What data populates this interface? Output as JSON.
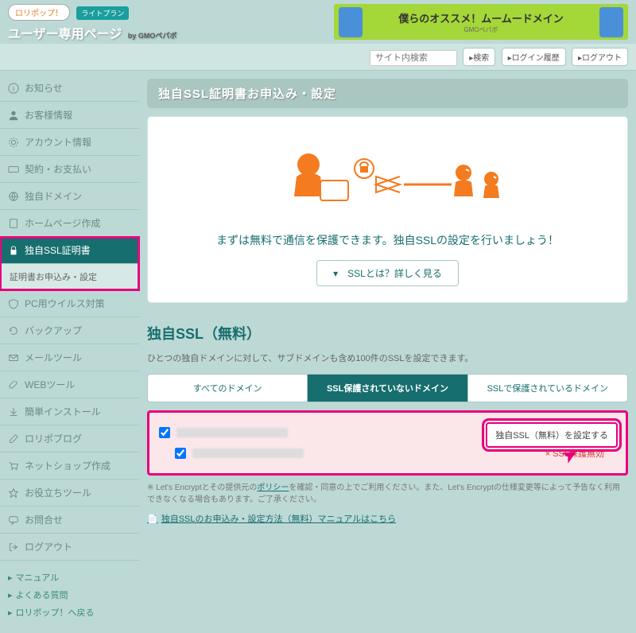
{
  "header": {
    "logo_badge": "ロリポップ！",
    "plan_badge": "ライトプラン",
    "logo_text": "ユーザー専用ページ",
    "logo_sub": "by GMOペパボ",
    "banner_text": "僕らのオススメ！ムームードメイン",
    "banner_sub": "GMOペパボ"
  },
  "topbar": {
    "search_placeholder": "サイト内検索",
    "btn_search": "▸検索",
    "btn_history": "▸ログイン履歴",
    "btn_logout": "▸ログアウト"
  },
  "sidebar": {
    "items": [
      {
        "label": "お知らせ"
      },
      {
        "label": "お客様情報"
      },
      {
        "label": "アカウント情報"
      },
      {
        "label": "契約・お支払い"
      },
      {
        "label": "独自ドメイン"
      },
      {
        "label": "ホームページ作成"
      },
      {
        "label": "独自SSL証明書",
        "active": true
      },
      {
        "label": "PC用ウイルス対策"
      },
      {
        "label": "バックアップ"
      },
      {
        "label": "メールツール"
      },
      {
        "label": "WEBツール"
      },
      {
        "label": "簡単インストール"
      },
      {
        "label": "ロリポブログ"
      },
      {
        "label": "ネットショップ作成"
      },
      {
        "label": "お役立ちツール"
      },
      {
        "label": "お問合せ"
      },
      {
        "label": "ログアウト"
      }
    ],
    "sub_item": "証明書お申込み・設定",
    "footer_links": [
      "マニュアル",
      "よくある質問",
      "ロリポップ！へ戻る"
    ]
  },
  "main": {
    "page_title": "独自SSL証明書お申込み・設定",
    "hero_msg": "まずは無料で通信を保護できます。独自SSLの設定を行いましょう！",
    "ssl_btn": "▾　SSLとは？詳しく見る",
    "section_title": "独自SSL（無料）",
    "section_desc": "ひとつの独自ドメインに対して、サブドメインも含め100件のSSLを設定できます。",
    "tabs": [
      "すべてのドメイン",
      "SSL保護されていないドメイン",
      "SSLで保護されているドメイン"
    ],
    "ssl_status": "× SSL保護無効",
    "set_btn": "独自SSL（無料）を設定する",
    "footnote_prefix": "※ Let's Encryptとその提供元の",
    "footnote_link": "ポリシー",
    "footnote_suffix": "を確認・同意の上でご利用ください。また、Let's Encryptの仕様変更等によって予告なく利用できなくなる場合もあります。ご了承ください。",
    "manual_link": "独自SSLのお申込み・設定方法（無料）マニュアルはこちら"
  }
}
